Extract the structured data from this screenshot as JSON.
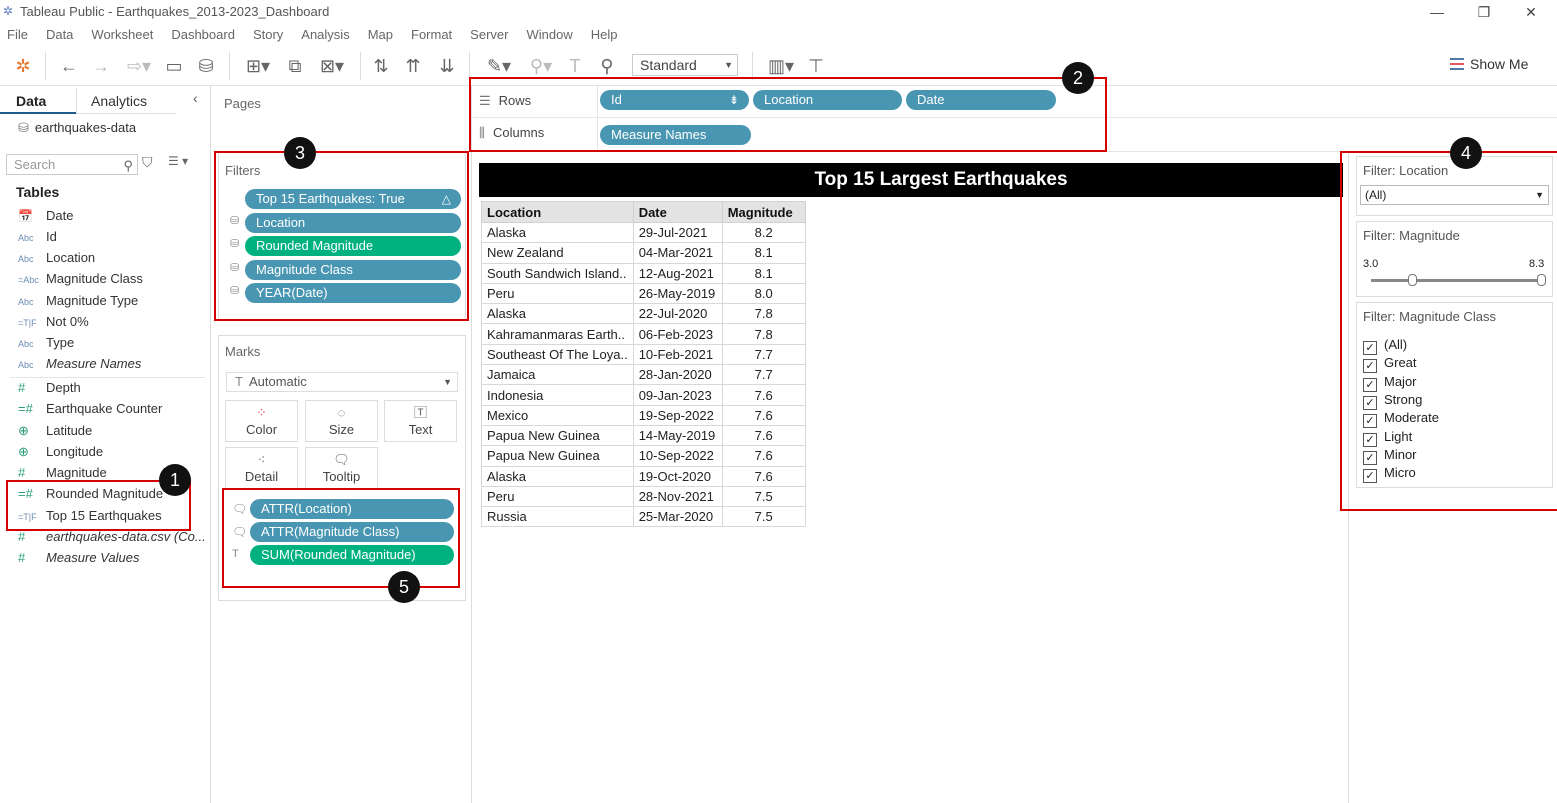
{
  "window": {
    "title": "Tableau Public - Earthquakes_2013-2023_Dashboard",
    "minimize": "—",
    "restore": "❐",
    "close": "✕"
  },
  "menu": [
    "File",
    "Data",
    "Worksheet",
    "Dashboard",
    "Story",
    "Analysis",
    "Map",
    "Format",
    "Server",
    "Window",
    "Help"
  ],
  "toolbar": {
    "fit_select": "Standard",
    "show_me": "Show Me"
  },
  "datapane": {
    "tab_data": "Data",
    "tab_analytics": "Analytics",
    "datasource": "earthquakes-data",
    "search_placeholder": "Search",
    "tables_heading": "Tables",
    "fields": [
      {
        "type": "cal",
        "type_label": "",
        "name": "Date"
      },
      {
        "type": "str",
        "type_label": "Abc",
        "name": "Id"
      },
      {
        "type": "str",
        "type_label": "Abc",
        "name": "Location"
      },
      {
        "type": "str",
        "type_label": "=Abc",
        "name": "Magnitude Class"
      },
      {
        "type": "str",
        "type_label": "Abc",
        "name": "Magnitude Type"
      },
      {
        "type": "bool",
        "type_label": "=T|F",
        "name": "Not 0%"
      },
      {
        "type": "str",
        "type_label": "Abc",
        "name": "Type"
      },
      {
        "type": "str",
        "type_label": "Abc",
        "name": "Measure Names",
        "italic": true
      },
      {
        "type": "num",
        "type_label": "#",
        "name": "Depth"
      },
      {
        "type": "num",
        "type_label": "=#",
        "name": "Earthquake Counter"
      },
      {
        "type": "geo",
        "type_label": "⊕",
        "name": "Latitude"
      },
      {
        "type": "geo",
        "type_label": "⊕",
        "name": "Longitude"
      },
      {
        "type": "num",
        "type_label": "#",
        "name": "Magnitude"
      },
      {
        "type": "num",
        "type_label": "=#",
        "name": "Rounded Magnitude"
      },
      {
        "type": "bool",
        "type_label": "=T|F",
        "name": "Top 15 Earthquakes"
      },
      {
        "type": "num",
        "type_label": "#",
        "name": "earthquakes-data.csv (Co...",
        "italic": true
      },
      {
        "type": "num",
        "type_label": "#",
        "name": "Measure Values",
        "italic": true
      }
    ]
  },
  "pages": {
    "title": "Pages"
  },
  "filters": {
    "title": "Filters",
    "pills": [
      {
        "label": "Top 15 Earthquakes: True",
        "color": "blue",
        "right": "△"
      },
      {
        "label": "Location",
        "color": "blue"
      },
      {
        "label": "Rounded Magnitude",
        "color": "green"
      },
      {
        "label": "Magnitude Class",
        "color": "blue"
      },
      {
        "label": "YEAR(Date)",
        "color": "blue"
      }
    ]
  },
  "marks": {
    "title": "Marks",
    "type": "Automatic",
    "buttons": [
      "Color",
      "Size",
      "Text",
      "Detail",
      "Tooltip"
    ],
    "pills": [
      {
        "label": "ATTR(Location)",
        "color": "blue"
      },
      {
        "label": "ATTR(Magnitude Class)",
        "color": "blue"
      },
      {
        "label": "SUM(Rounded Magnitude)",
        "color": "green"
      }
    ]
  },
  "rows": {
    "label": "Rows",
    "pills": [
      "Id",
      "Location",
      "Date"
    ]
  },
  "columns": {
    "label": "Columns",
    "pills": [
      "Measure Names"
    ]
  },
  "viz": {
    "title": "Top 15 Largest Earthquakes",
    "headers": [
      "Location",
      "Date",
      "Magnitude"
    ],
    "rows": [
      [
        "Alaska",
        "29-Jul-2021",
        "8.2"
      ],
      [
        "New Zealand",
        "04-Mar-2021",
        "8.1"
      ],
      [
        "South Sandwich Island..",
        "12-Aug-2021",
        "8.1"
      ],
      [
        "Peru",
        "26-May-2019",
        "8.0"
      ],
      [
        "Alaska",
        "22-Jul-2020",
        "7.8"
      ],
      [
        "Kahramanmaras Earth..",
        "06-Feb-2023",
        "7.8"
      ],
      [
        "Southeast Of The Loya..",
        "10-Feb-2021",
        "7.7"
      ],
      [
        "Jamaica",
        "28-Jan-2020",
        "7.7"
      ],
      [
        "Indonesia",
        "09-Jan-2023",
        "7.6"
      ],
      [
        "Mexico",
        "19-Sep-2022",
        "7.6"
      ],
      [
        "Papua New Guinea",
        "14-May-2019",
        "7.6"
      ],
      [
        "Papua New Guinea",
        "10-Sep-2022",
        "7.6"
      ],
      [
        "Alaska",
        "19-Oct-2020",
        "7.6"
      ],
      [
        "Peru",
        "28-Nov-2021",
        "7.5"
      ],
      [
        "Russia",
        "25-Mar-2020",
        "7.5"
      ]
    ]
  },
  "quick_filters": {
    "location": {
      "title": "Filter: Location",
      "value": "(All)"
    },
    "magnitude": {
      "title": "Filter: Magnitude",
      "min": "3.0",
      "max": "8.3"
    },
    "magnitude_class": {
      "title": "Filter: Magnitude Class",
      "options": [
        "(All)",
        "Great",
        "Major",
        "Strong",
        "Moderate",
        "Light",
        "Minor",
        "Micro"
      ]
    }
  },
  "annotations": [
    "1",
    "2",
    "3",
    "4",
    "5"
  ],
  "colors": {
    "pill_blue": "#4996b2",
    "pill_green": "#00b180",
    "annotation_red": "#d40000"
  }
}
